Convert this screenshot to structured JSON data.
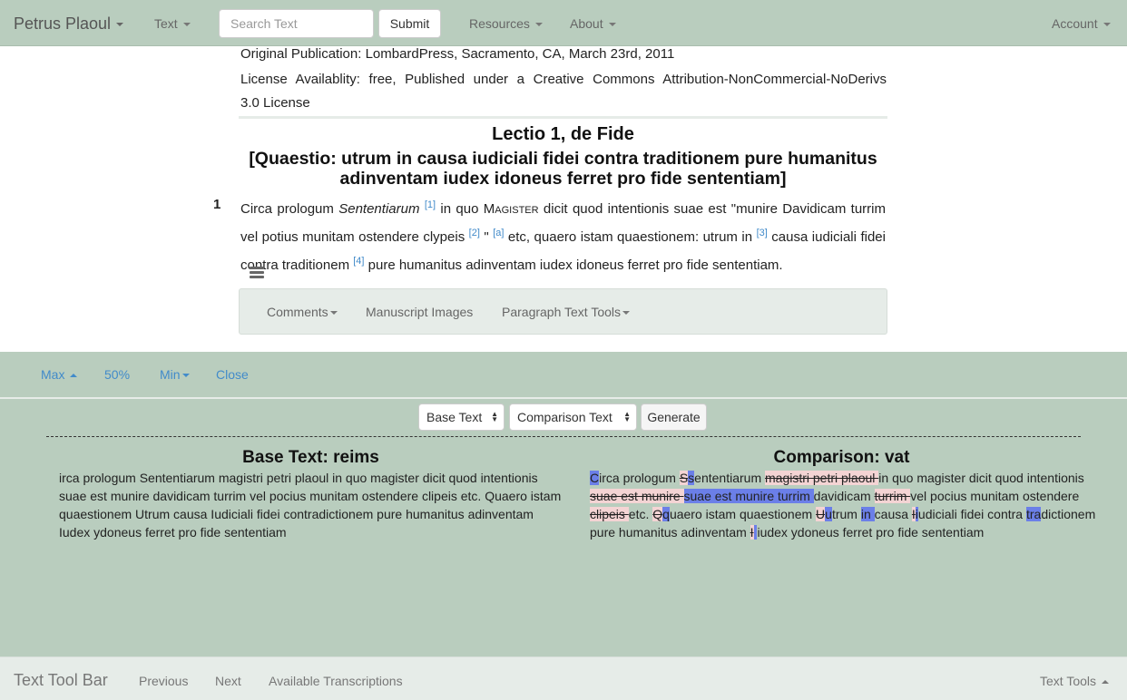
{
  "navbar": {
    "brand": "Petrus Plaoul",
    "text_menu": "Text",
    "search_placeholder": "Search Text",
    "submit": "Submit",
    "resources": "Resources",
    "about": "About",
    "account": "Account"
  },
  "meta": {
    "publication": "Original Publication: LombardPress, Sacramento, CA, March 23rd, 2011",
    "license_line1": "License Availablity: free, Published under a Creative Commons Attribution-NonCommercial-NoDerivs",
    "license_line2": "3.0 License"
  },
  "heading": {
    "title": "Lectio 1, de Fide",
    "question": "[Quaestio: utrum in causa iudiciali fidei contra traditionem pure humanitus adinventam iudex idoneus ferret pro fide sententiam]"
  },
  "paragraph": {
    "number": "1",
    "t1": "Circa prologum ",
    "t2": "Sententiarum",
    "n1": "[1]",
    "t3": " in quo ",
    "t4": "Magister",
    "t5": " dicit quod intentionis suae est \"munire Davidicam turrim vel potius munitam ostendere clypeis ",
    "n2": "[2]",
    "t6": " \" ",
    "n3": "[a]",
    "t7": " etc, quaero istam quaestionem: utrum in ",
    "n4": "[3]",
    "t8": " causa iudiciali fidei contra traditionem ",
    "n5": "[4]",
    "t9": " pure humanitus adinventam iudex idoneus ferret pro fide sententiam."
  },
  "paragraph_tools": {
    "comments": "Comments",
    "manuscript_images": "Manuscript Images",
    "text_tools": "Paragraph Text Tools"
  },
  "pane": {
    "max": "Max",
    "half": "50%",
    "min": "Min",
    "close": "Close",
    "base_select": "Base Text",
    "comparison_select": "Comparison Text",
    "generate": "Generate",
    "base_heading": "Base Text: reims",
    "comparison_heading": "Comparison: vat",
    "base_text": "irca prologum Sententiarum magistri petri plaoul in quo magister dicit quod intentionis suae est munire davidicam turrim vel pocius munitam ostendere clipeis etc. Quaero istam quaestionem Utrum causa Iudiciali fidei contradictionem pure humanitus adinventam Iudex ydoneus ferret pro fide sententiam",
    "cmp": {
      "c1": "C",
      "c2": "irca prologum ",
      "c3": "S",
      "c4": "s",
      "c5": "ententiarum ",
      "c6": "magistri petri plaoul ",
      "c7": "in quo magister dicit quod intentionis ",
      "c8": "suae est munire ",
      "c9": " suae est munire turrim ",
      "c10": "davidicam ",
      "c11": "turrim ",
      "c12": "vel pocius munitam ostendere ",
      "c13": "clipeis ",
      "c14": "etc. ",
      "c15": "Q",
      "c16": "q",
      "c17": "uaero istam quaestionem ",
      "c18": "U",
      "c19": "u",
      "c20": "trum ",
      "c21": "in ",
      "c22": "causa ",
      "c23": "I",
      "c24": "i",
      "c25": "udiciali fidei contra ",
      "c26": "tra",
      "c27": "di",
      "c28": "ctionem pure humanitus adinventam ",
      "c29": "I",
      "c30": " ",
      "c31": "iudex ydoneus ferret pro fide sententiam"
    }
  },
  "bottom_bar": {
    "title": "Text Tool Bar",
    "previous": "Previous",
    "next": "Next",
    "available": "Available Transcriptions",
    "text_tools": "Text Tools"
  }
}
